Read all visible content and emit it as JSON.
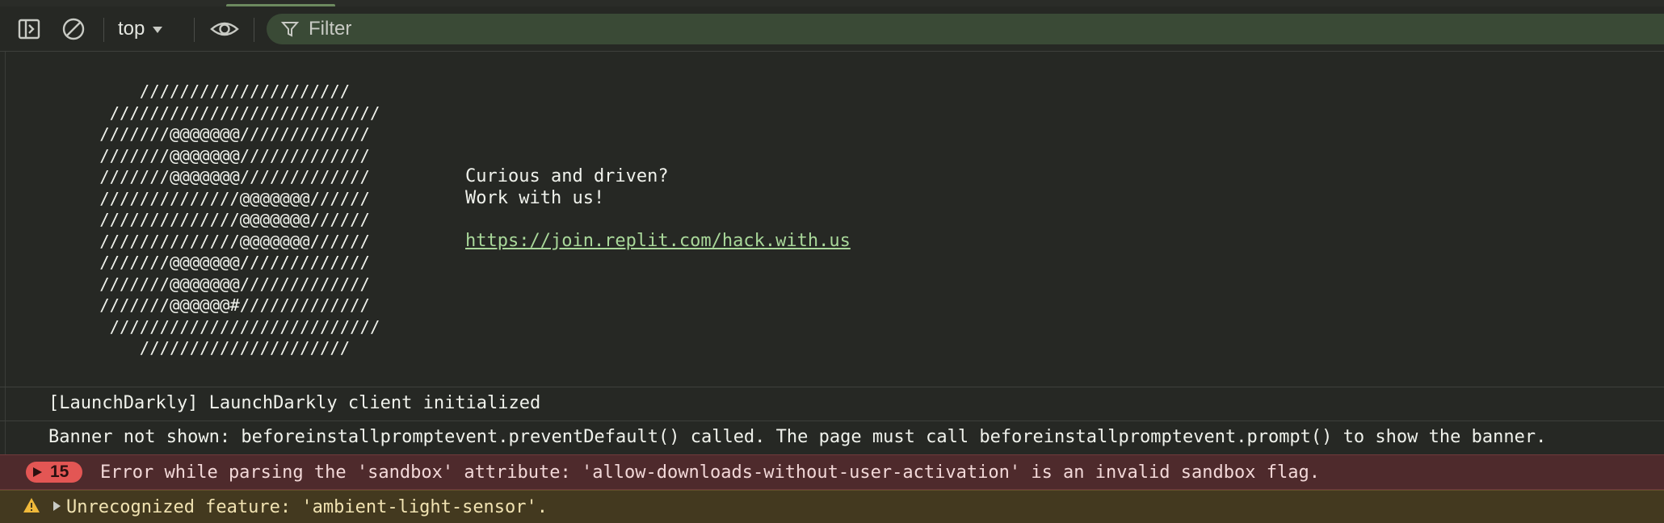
{
  "toolbar": {
    "context_label": "top",
    "filter_placeholder": "Filter"
  },
  "console": {
    "ascii_art": "       /////////////////////\n    ///////////////////////////\n   ///////@@@@@@@/////////////\n   ///////@@@@@@@/////////////\n   ///////@@@@@@@/////////////\n   //////////////@@@@@@@//////\n   //////////////@@@@@@@//////\n   //////////////@@@@@@@//////\n   ///////@@@@@@@/////////////\n   ///////@@@@@@@/////////////\n   ///////@@@@@@#/////////////\n    ///////////////////////////\n       /////////////////////",
    "banner_line1": "Curious and driven?",
    "banner_line2": "Work with us!",
    "banner_link": "https://join.replit.com/hack.with.us",
    "messages": [
      {
        "level": "info",
        "text": "[LaunchDarkly] LaunchDarkly client initialized"
      },
      {
        "level": "info",
        "text": "Banner not shown: beforeinstallpromptevent.preventDefault() called. The page must call beforeinstallpromptevent.prompt() to show the banner."
      },
      {
        "level": "error",
        "count": "15",
        "text": "Error while parsing the 'sandbox' attribute: 'allow-downloads-without-user-activation' is an invalid sandbox flag."
      },
      {
        "level": "warning",
        "text": "Unrecognized feature: 'ambient-light-sensor'."
      }
    ]
  },
  "colors": {
    "background": "#262824",
    "error_background": "#4e2a2c",
    "error_badge": "#e35654",
    "warning_background": "#43391f",
    "link": "#a9d89a"
  },
  "icons": [
    "sidebar-toggle-icon",
    "clear-console-icon",
    "chevron-down-icon",
    "eye-icon",
    "filter-icon",
    "error-triangle-icon",
    "warning-icon",
    "expand-arrow-icon"
  ]
}
